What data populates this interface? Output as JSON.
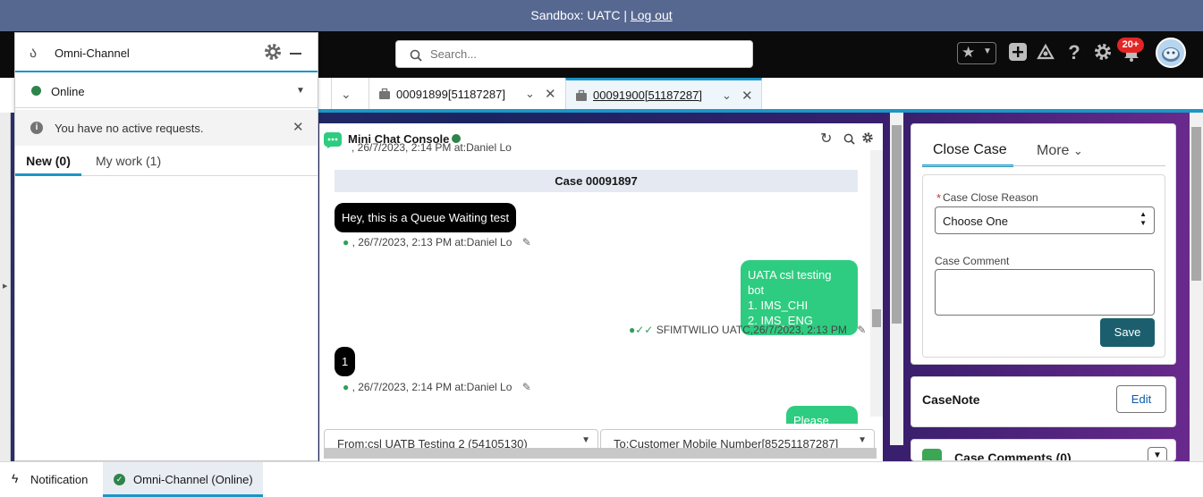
{
  "sandbox": {
    "label": "Sandbox: UATC |",
    "logout": "Log out"
  },
  "search": {
    "placeholder": "Search..."
  },
  "header": {
    "notification_count": "20+"
  },
  "omni": {
    "title": "Omni-Channel",
    "status": "Online",
    "message": "You have no active requests.",
    "tab_new": "New (0)",
    "tab_work": "My work (1)"
  },
  "tabs": [
    {
      "label": "00091899[51187287]"
    },
    {
      "label": "00091900[51187287]"
    }
  ],
  "chat": {
    "title": "Mini Chat Console",
    "cut_meta": ", 26/7/2023, 2:14 PM at:Daniel Lo",
    "case_header": "Case 00091897",
    "msg1": "Hey, this is a Queue Waiting test",
    "msg1_meta": ", 26/7/2023, 2:13 PM at:Daniel Lo",
    "msg2_line1": "UATA csl testing bot",
    "msg2_line2": "1. IMS_CHI",
    "msg2_line3": "2. IMS_ENG",
    "msg2_meta": "SFIMTWILIO UATC,26/7/2023, 2:13 PM",
    "msg3": "1",
    "msg3_meta": ", 26/7/2023, 2:14 PM at:Daniel Lo",
    "msg4_cut": "Please wait",
    "from_select": "From:csl UATB Testing 2 (54105130)",
    "to_select": "To:Customer Mobile Number[85251187287]"
  },
  "closecase": {
    "tab_close": "Close Case",
    "tab_more": "More",
    "reason_label": "Case Close Reason",
    "reason_value": "Choose One",
    "comment_label": "Case Comment",
    "save": "Save"
  },
  "casenote": {
    "title": "CaseNote",
    "edit": "Edit"
  },
  "comments": {
    "title": "Case Comments (0)"
  },
  "utility": {
    "notification": "Notification",
    "omni": "Omni-Channel (Online)"
  },
  "colors": {
    "accent": "#1b96c7",
    "online": "#2e844a",
    "chat_green": "#2ecc80",
    "save": "#1b5f6e"
  }
}
